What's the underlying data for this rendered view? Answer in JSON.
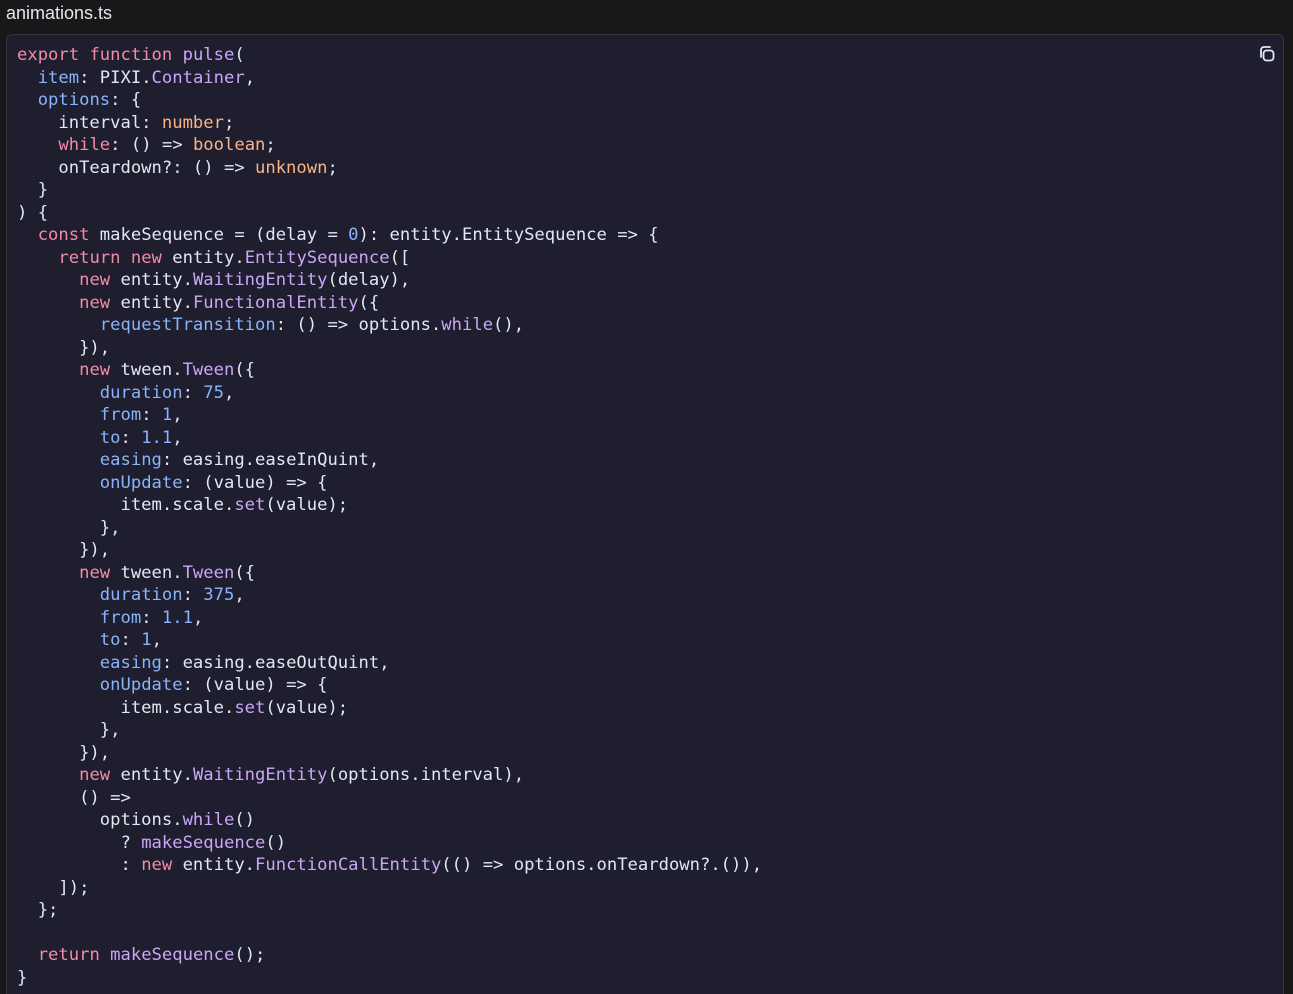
{
  "file": {
    "title": "animations.ts"
  },
  "toolbar": {
    "copy_icon": "copy-icon"
  },
  "colors": {
    "background": "#18181b",
    "panel": "#1e1e2e",
    "keyword": "#f38ba8",
    "function": "#cba6f7",
    "property": "#89b4fa",
    "type": "#fab387",
    "text": "#e4e7f2"
  },
  "code": {
    "lines": [
      [
        [
          "k",
          "export"
        ],
        [
          "o",
          " "
        ],
        [
          "k",
          "function"
        ],
        [
          "o",
          " "
        ],
        [
          "f",
          "pulse"
        ],
        [
          "o",
          "("
        ]
      ],
      [
        [
          "o",
          "  "
        ],
        [
          "p",
          "item"
        ],
        [
          "o",
          ": PIXI."
        ],
        [
          "f",
          "Container"
        ],
        [
          "o",
          ","
        ]
      ],
      [
        [
          "o",
          "  "
        ],
        [
          "p",
          "options"
        ],
        [
          "o",
          ": {"
        ]
      ],
      [
        [
          "o",
          "    interval: "
        ],
        [
          "t",
          "number"
        ],
        [
          "o",
          ";"
        ]
      ],
      [
        [
          "o",
          "    "
        ],
        [
          "k",
          "while"
        ],
        [
          "o",
          ": () => "
        ],
        [
          "t",
          "boolean"
        ],
        [
          "o",
          ";"
        ]
      ],
      [
        [
          "o",
          "    onTeardown?: () => "
        ],
        [
          "t",
          "unknown"
        ],
        [
          "o",
          ";"
        ]
      ],
      [
        [
          "o",
          "  }"
        ]
      ],
      [
        [
          "o",
          ") {"
        ]
      ],
      [
        [
          "o",
          "  "
        ],
        [
          "k",
          "const"
        ],
        [
          "o",
          " makeSequence = (delay = "
        ],
        [
          "n",
          "0"
        ],
        [
          "o",
          "): entity.EntitySequence => {"
        ]
      ],
      [
        [
          "o",
          "    "
        ],
        [
          "k",
          "return"
        ],
        [
          "o",
          " "
        ],
        [
          "k",
          "new"
        ],
        [
          "o",
          " entity."
        ],
        [
          "f",
          "EntitySequence"
        ],
        [
          "o",
          "(["
        ]
      ],
      [
        [
          "o",
          "      "
        ],
        [
          "k",
          "new"
        ],
        [
          "o",
          " entity."
        ],
        [
          "f",
          "WaitingEntity"
        ],
        [
          "o",
          "(delay),"
        ]
      ],
      [
        [
          "o",
          "      "
        ],
        [
          "k",
          "new"
        ],
        [
          "o",
          " entity."
        ],
        [
          "f",
          "FunctionalEntity"
        ],
        [
          "o",
          "({"
        ]
      ],
      [
        [
          "o",
          "        "
        ],
        [
          "p",
          "requestTransition"
        ],
        [
          "o",
          ": () => options."
        ],
        [
          "f",
          "while"
        ],
        [
          "o",
          "(),"
        ]
      ],
      [
        [
          "o",
          "      }),"
        ]
      ],
      [
        [
          "o",
          "      "
        ],
        [
          "k",
          "new"
        ],
        [
          "o",
          " tween."
        ],
        [
          "f",
          "Tween"
        ],
        [
          "o",
          "({"
        ]
      ],
      [
        [
          "o",
          "        "
        ],
        [
          "p",
          "duration"
        ],
        [
          "o",
          ": "
        ],
        [
          "n",
          "75"
        ],
        [
          "o",
          ","
        ]
      ],
      [
        [
          "o",
          "        "
        ],
        [
          "p",
          "from"
        ],
        [
          "o",
          ": "
        ],
        [
          "n",
          "1"
        ],
        [
          "o",
          ","
        ]
      ],
      [
        [
          "o",
          "        "
        ],
        [
          "p",
          "to"
        ],
        [
          "o",
          ": "
        ],
        [
          "n",
          "1.1"
        ],
        [
          "o",
          ","
        ]
      ],
      [
        [
          "o",
          "        "
        ],
        [
          "p",
          "easing"
        ],
        [
          "o",
          ": easing.easeInQuint,"
        ]
      ],
      [
        [
          "o",
          "        "
        ],
        [
          "p",
          "onUpdate"
        ],
        [
          "o",
          ": (value) => {"
        ]
      ],
      [
        [
          "o",
          "          item.scale."
        ],
        [
          "f",
          "set"
        ],
        [
          "o",
          "(value);"
        ]
      ],
      [
        [
          "o",
          "        },"
        ]
      ],
      [
        [
          "o",
          "      }),"
        ]
      ],
      [
        [
          "o",
          "      "
        ],
        [
          "k",
          "new"
        ],
        [
          "o",
          " tween."
        ],
        [
          "f",
          "Tween"
        ],
        [
          "o",
          "({"
        ]
      ],
      [
        [
          "o",
          "        "
        ],
        [
          "p",
          "duration"
        ],
        [
          "o",
          ": "
        ],
        [
          "n",
          "375"
        ],
        [
          "o",
          ","
        ]
      ],
      [
        [
          "o",
          "        "
        ],
        [
          "p",
          "from"
        ],
        [
          "o",
          ": "
        ],
        [
          "n",
          "1.1"
        ],
        [
          "o",
          ","
        ]
      ],
      [
        [
          "o",
          "        "
        ],
        [
          "p",
          "to"
        ],
        [
          "o",
          ": "
        ],
        [
          "n",
          "1"
        ],
        [
          "o",
          ","
        ]
      ],
      [
        [
          "o",
          "        "
        ],
        [
          "p",
          "easing"
        ],
        [
          "o",
          ": easing.easeOutQuint,"
        ]
      ],
      [
        [
          "o",
          "        "
        ],
        [
          "p",
          "onUpdate"
        ],
        [
          "o",
          ": (value) => {"
        ]
      ],
      [
        [
          "o",
          "          item.scale."
        ],
        [
          "f",
          "set"
        ],
        [
          "o",
          "(value);"
        ]
      ],
      [
        [
          "o",
          "        },"
        ]
      ],
      [
        [
          "o",
          "      }),"
        ]
      ],
      [
        [
          "o",
          "      "
        ],
        [
          "k",
          "new"
        ],
        [
          "o",
          " entity."
        ],
        [
          "f",
          "WaitingEntity"
        ],
        [
          "o",
          "(options.interval),"
        ]
      ],
      [
        [
          "o",
          "      () =>"
        ]
      ],
      [
        [
          "o",
          "        options."
        ],
        [
          "f",
          "while"
        ],
        [
          "o",
          "()"
        ]
      ],
      [
        [
          "o",
          "          ? "
        ],
        [
          "f",
          "makeSequence"
        ],
        [
          "o",
          "()"
        ]
      ],
      [
        [
          "o",
          "          : "
        ],
        [
          "k",
          "new"
        ],
        [
          "o",
          " entity."
        ],
        [
          "f",
          "FunctionCallEntity"
        ],
        [
          "o",
          "(() => options.onTeardown?.()),"
        ]
      ],
      [
        [
          "o",
          "    ]);"
        ]
      ],
      [
        [
          "o",
          "  };"
        ]
      ],
      [
        [
          "o",
          ""
        ]
      ],
      [
        [
          "o",
          "  "
        ],
        [
          "k",
          "return"
        ],
        [
          "o",
          " "
        ],
        [
          "f",
          "makeSequence"
        ],
        [
          "o",
          "();"
        ]
      ],
      [
        [
          "o",
          "}"
        ]
      ]
    ]
  }
}
